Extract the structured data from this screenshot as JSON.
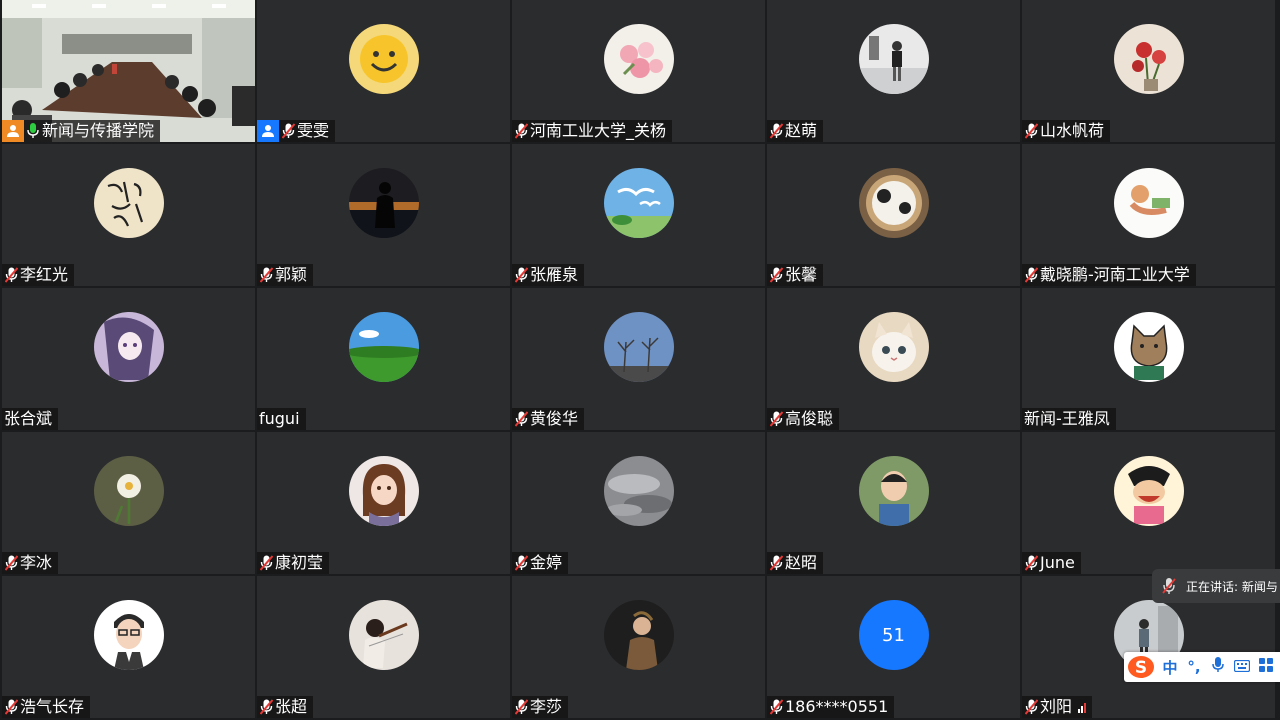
{
  "tiles": [
    {
      "name": "新闻与传播学院",
      "avatar": "conference-room-video",
      "mic": "on",
      "badge": "host",
      "active": true
    },
    {
      "name": "雯雯",
      "avatar": "smiley-face",
      "mic": "muted",
      "badge": "user"
    },
    {
      "name": "河南工业大学_关杨",
      "avatar": "pink-roses",
      "mic": "muted"
    },
    {
      "name": "赵萌",
      "avatar": "person-standing",
      "mic": "muted"
    },
    {
      "name": "山水帆荷",
      "avatar": "red-flowers-vase",
      "mic": "muted"
    },
    {
      "name": "李红光",
      "avatar": "calligraphy",
      "mic": "muted"
    },
    {
      "name": "郭颖",
      "avatar": "silhouette-sunset",
      "mic": "muted"
    },
    {
      "name": "张雁泉",
      "avatar": "birds-sky",
      "mic": "muted"
    },
    {
      "name": "张馨",
      "avatar": "cat-in-basket",
      "mic": "muted"
    },
    {
      "name": "戴晓鹏-河南工业大学",
      "avatar": "illustrated-girl-reading",
      "mic": "muted"
    },
    {
      "name": "张合斌",
      "avatar": "anime-girl",
      "mic": "none"
    },
    {
      "name": "fugui",
      "avatar": "green-field",
      "mic": "none"
    },
    {
      "name": "黄俊华",
      "avatar": "bare-trees-sky",
      "mic": "muted"
    },
    {
      "name": "高俊聪",
      "avatar": "white-kitten",
      "mic": "muted"
    },
    {
      "name": "新闻-王雅凤",
      "avatar": "cartoon-cat",
      "mic": "none"
    },
    {
      "name": "李冰",
      "avatar": "narcissus-flower",
      "mic": "muted"
    },
    {
      "name": "康初莹",
      "avatar": "cartoon-girl",
      "mic": "muted"
    },
    {
      "name": "金婷",
      "avatar": "cloudy-sky",
      "mic": "muted"
    },
    {
      "name": "赵昭",
      "avatar": "child-portrait",
      "mic": "muted"
    },
    {
      "name": "June",
      "avatar": "cartoon-laughing",
      "mic": "muted"
    },
    {
      "name": "浩气长存",
      "avatar": "cartoon-man-glasses",
      "mic": "muted"
    },
    {
      "name": "张超",
      "avatar": "violinist",
      "mic": "muted"
    },
    {
      "name": "李莎",
      "avatar": "girl-dark",
      "mic": "muted"
    },
    {
      "name": "186****0551",
      "avatar": "number",
      "avatar_text": "51",
      "mic": "muted"
    },
    {
      "name": "刘阳",
      "avatar": "person-street",
      "mic": "muted",
      "signal": true
    }
  ],
  "speaking": {
    "text": "正在讲话: 新闻与"
  },
  "ime": {
    "items": [
      "中",
      "°,",
      "mic-icon",
      "keyboard-icon",
      "grid-icon"
    ],
    "lang": "中",
    "punct": "°,"
  },
  "colors": {
    "host_badge": "#f08a24",
    "user_badge": "#1677ff",
    "active_border": "#29c24a",
    "number_avatar": "#1677ff"
  }
}
